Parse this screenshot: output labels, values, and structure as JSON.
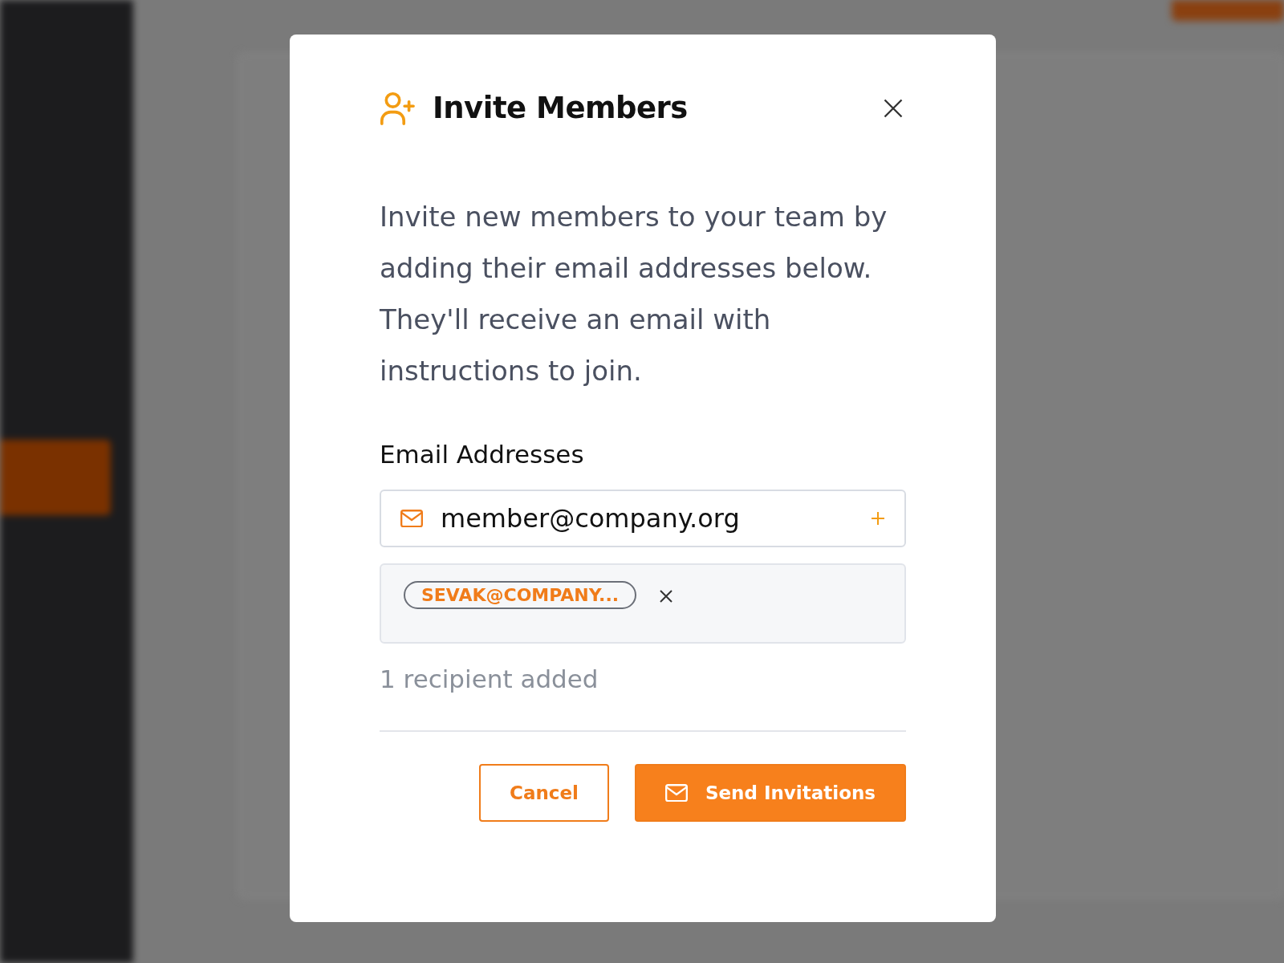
{
  "dialog": {
    "title": "Invite Members",
    "description": "Invite new members to your team by adding their email addresses below. They'll receive an email with instructions to join.",
    "email_label": "Email Addresses",
    "email_input": {
      "value": "member@company.org"
    },
    "recipients": [
      {
        "label": "SEVAK@COMPANY..."
      }
    ],
    "recipient_count": "1 recipient added",
    "buttons": [
      {
        "label": "Cancel",
        "kind": "secondary"
      },
      {
        "label": "Send Invitations",
        "kind": "primary"
      }
    ]
  }
}
